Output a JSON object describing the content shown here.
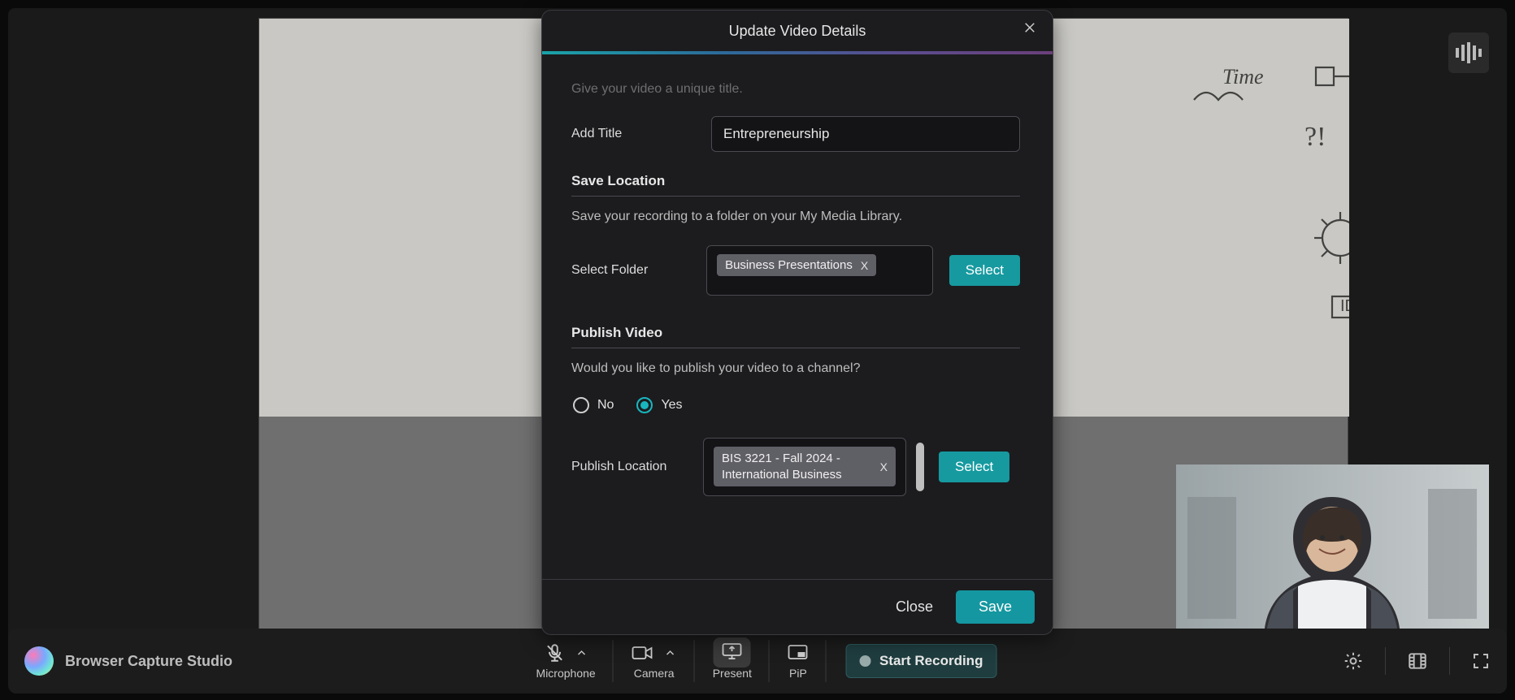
{
  "app": {
    "name": "Browser Capture Studio"
  },
  "toolbar": {
    "microphone": "Microphone",
    "camera": "Camera",
    "present": "Present",
    "pip": "PiP",
    "startRecording": "Start Recording"
  },
  "modal": {
    "title": "Update Video Details",
    "hintTop": "Give your video a unique title.",
    "addTitleLabel": "Add Title",
    "titleValue": "Entrepreneurship",
    "saveLocation": {
      "heading": "Save Location",
      "hint": "Save your recording to a folder on your My Media Library.",
      "selectFolderLabel": "Select Folder",
      "folderChip": "Business Presentations",
      "selectBtn": "Select"
    },
    "publish": {
      "heading": "Publish Video",
      "hint": "Would you like to publish your video to a channel?",
      "noLabel": "No",
      "yesLabel": "Yes",
      "selected": "yes",
      "locationLabel": "Publish Location",
      "locationChip": "BIS 3221 - Fall 2024 - International Business",
      "selectBtn": "Select"
    },
    "footer": {
      "close": "Close",
      "save": "Save"
    }
  }
}
